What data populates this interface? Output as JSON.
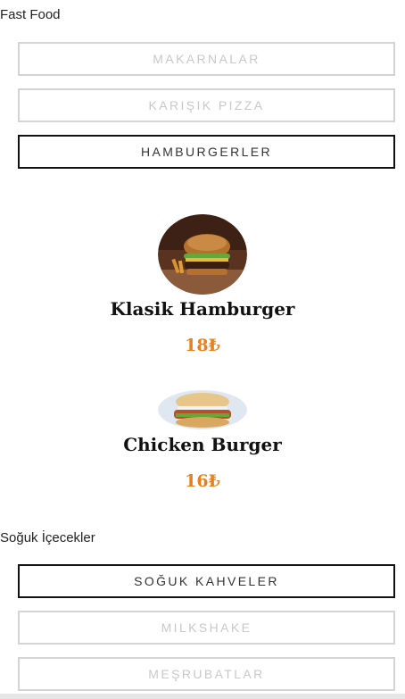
{
  "sections": [
    {
      "title": "Fast Food",
      "tabs": [
        "MAKARNALAR",
        "KARIŞIK PIZZA",
        "HAMBURGERLER"
      ],
      "active_tab": "HAMBURGERLER"
    },
    {
      "title": "Soğuk İçecekler",
      "tabs": [
        "SOĞUK KAHVELER",
        "MILKSHAKE",
        "MEŞRUBATLAR"
      ],
      "active_tab": "SOĞUK KAHVELER"
    }
  ],
  "items": [
    {
      "name": "Klasik Hamburger",
      "price": "18₺",
      "image": "hamburger-photo"
    },
    {
      "name": "Chicken Burger",
      "price": "16₺",
      "image": "chicken-burger-photo"
    }
  ],
  "colors": {
    "price": "#e8801c",
    "active_border": "#111111",
    "inactive_border": "#d4d4d4",
    "inactive_text": "#c8c8c8"
  }
}
